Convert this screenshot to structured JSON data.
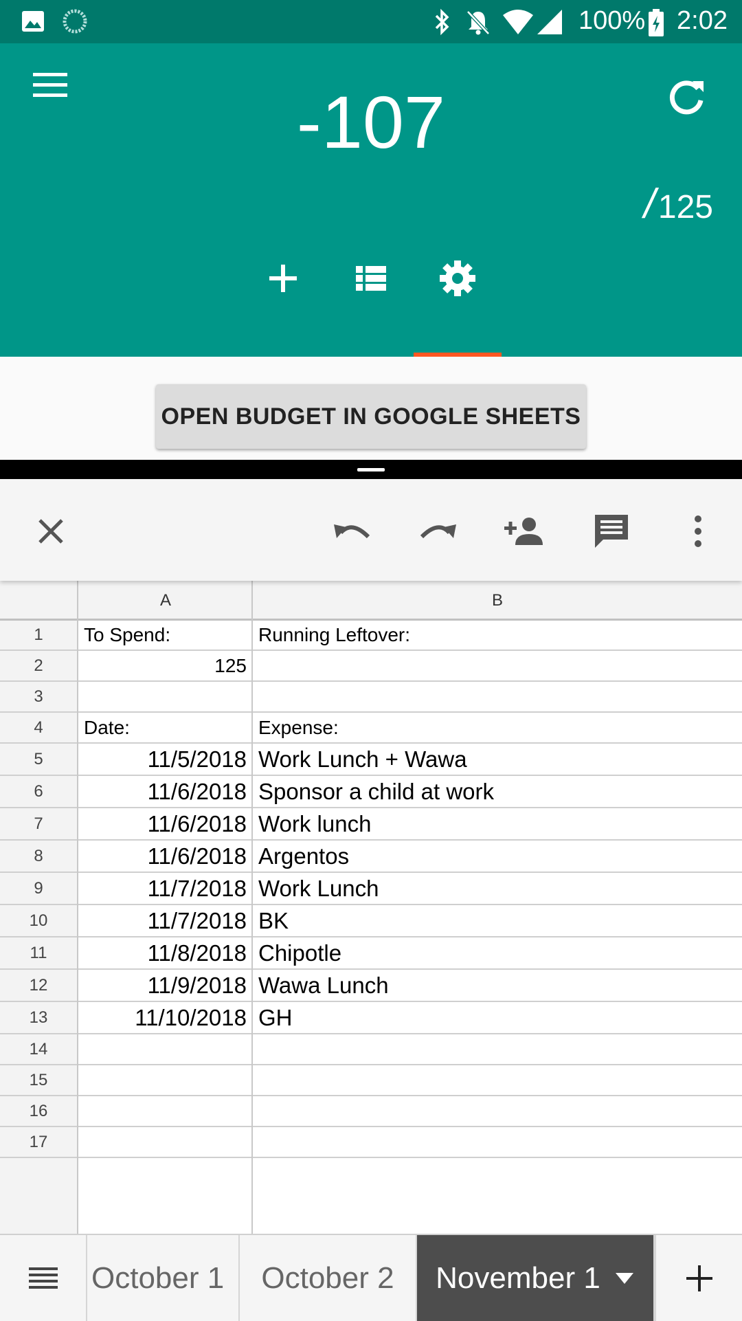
{
  "status_bar": {
    "battery": "100%",
    "time": "2:02"
  },
  "app": {
    "balance": "-107",
    "budget_total": "125",
    "slash": "/",
    "settings_button": "OPEN BUDGET IN GOOGLE SHEETS"
  },
  "sheet": {
    "columns": [
      "A",
      "B"
    ],
    "rows": [
      {
        "n": "1",
        "a": "To Spend:",
        "b": "Running Leftover:"
      },
      {
        "n": "2",
        "a": "125",
        "b": ""
      },
      {
        "n": "3",
        "a": "",
        "b": ""
      },
      {
        "n": "4",
        "a": "Date:",
        "b": "Expense:"
      },
      {
        "n": "5",
        "a": "11/5/2018",
        "b": "Work Lunch + Wawa"
      },
      {
        "n": "6",
        "a": "11/6/2018",
        "b": "Sponsor a child at work"
      },
      {
        "n": "7",
        "a": "11/6/2018",
        "b": "Work lunch"
      },
      {
        "n": "8",
        "a": "11/6/2018",
        "b": "Argentos"
      },
      {
        "n": "9",
        "a": "11/7/2018",
        "b": "Work Lunch"
      },
      {
        "n": "10",
        "a": "11/7/2018",
        "b": "BK"
      },
      {
        "n": "11",
        "a": "11/8/2018",
        "b": "Chipotle"
      },
      {
        "n": "12",
        "a": "11/9/2018",
        "b": "Wawa Lunch"
      },
      {
        "n": "13",
        "a": "11/10/2018",
        "b": "GH"
      },
      {
        "n": "14",
        "a": "",
        "b": ""
      },
      {
        "n": "15",
        "a": "",
        "b": ""
      },
      {
        "n": "16",
        "a": "",
        "b": ""
      },
      {
        "n": "17",
        "a": "",
        "b": ""
      }
    ]
  },
  "sheet_tabs": [
    "October 1",
    "October 2",
    "November 1"
  ],
  "colors": {
    "header": "#009688",
    "status": "#00796b",
    "accent": "#ff5722",
    "active_tab": "#4d4d4d"
  }
}
